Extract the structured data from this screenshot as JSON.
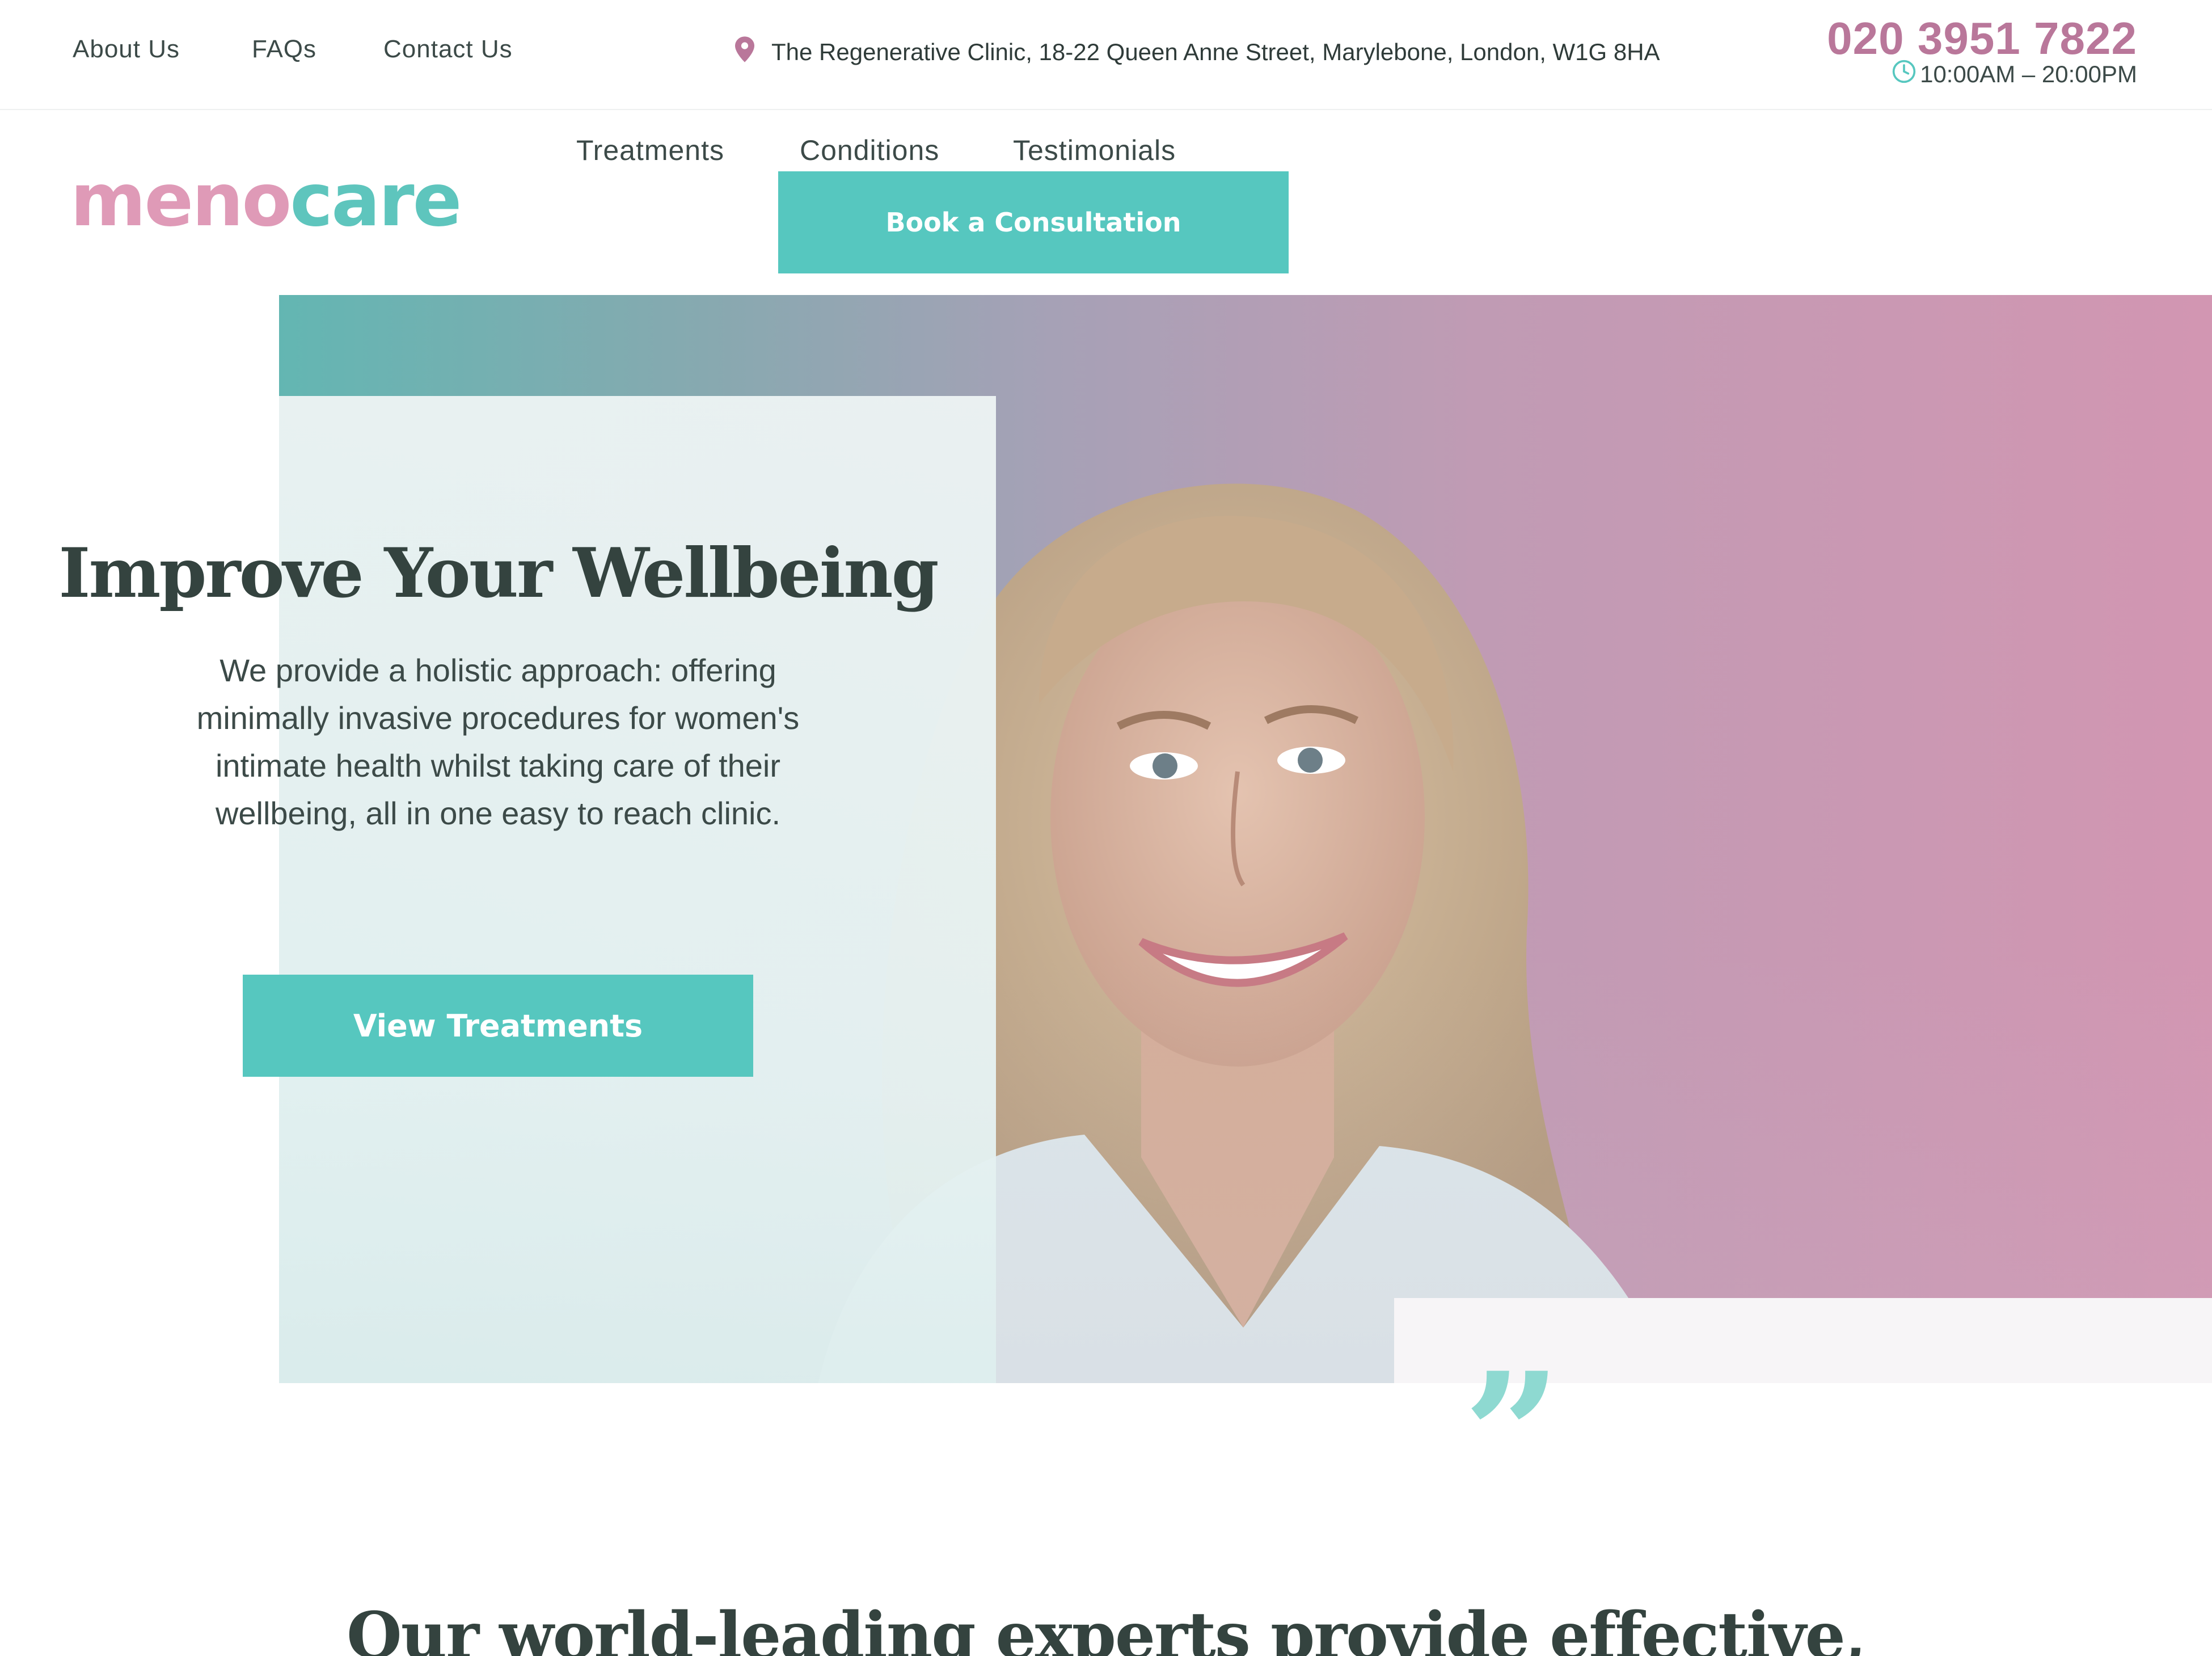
{
  "topbar": {
    "links": [
      "About Us",
      "FAQs",
      "Contact Us"
    ],
    "address": "The Regenerative Clinic, 18-22 Queen Anne Street, Marylebone, London, W1G 8HA",
    "phone": "020 3951 7822",
    "hours": "10:00AM – 20:00PM"
  },
  "logo": {
    "part1": "meno",
    "part2": "care"
  },
  "nav": {
    "items": [
      "Treatments",
      "Conditions",
      "Testimonials"
    ],
    "cta": "Book a Consultation"
  },
  "hero": {
    "title": "Improve Your Wellbeing",
    "text": "We provide a holistic approach: offering minimally invasive procedures for women's intimate health whilst taking care of their wellbeing, all in one easy to reach clinic.",
    "button": "View Treatments"
  },
  "quote": {
    "mark": "”"
  },
  "section": {
    "heading": "Our world-leading experts provide effective,"
  },
  "colors": {
    "teal": "#56c7bf",
    "pink": "#df9ab7",
    "phone": "#b9779a",
    "text": "#34433f"
  }
}
